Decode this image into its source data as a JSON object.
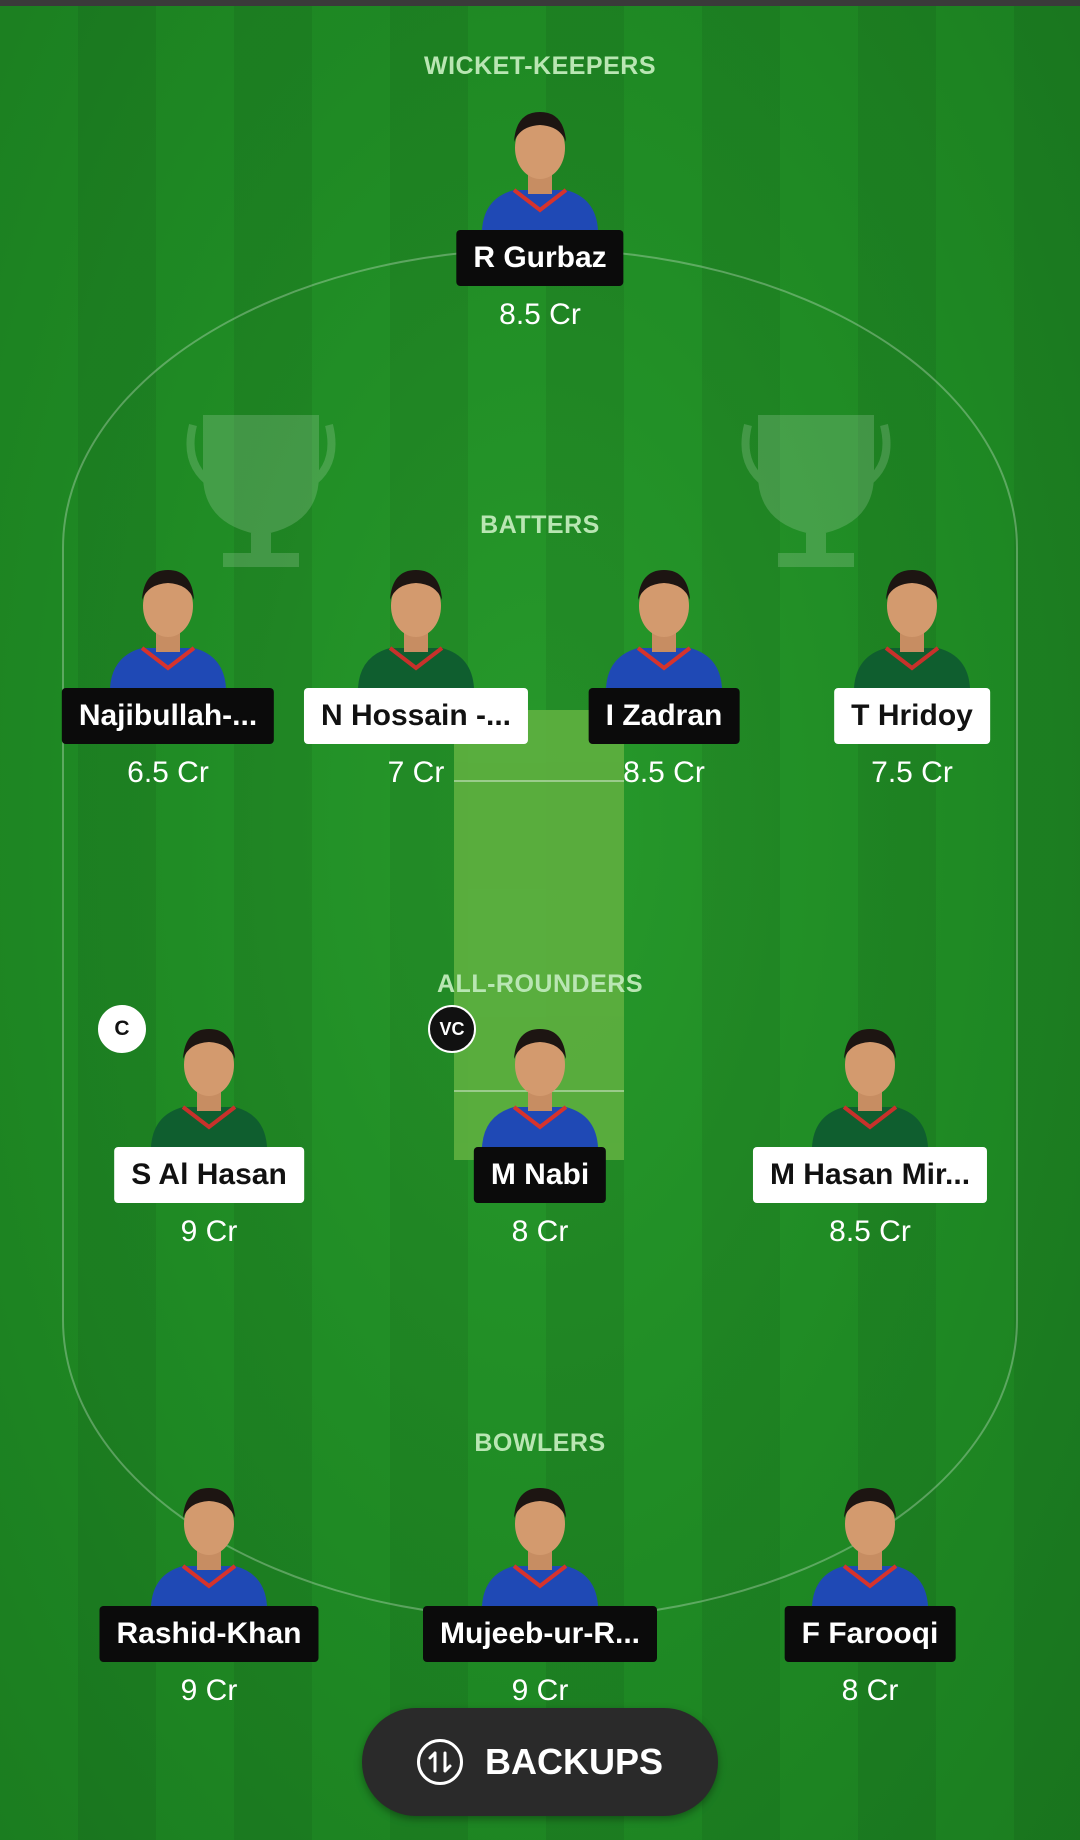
{
  "sections": {
    "wicket_keepers": "WICKET-KEEPERS",
    "batters": "BATTERS",
    "all_rounders": "ALL-ROUNDERS",
    "bowlers": "BOWLERS"
  },
  "players": {
    "wk1": {
      "name": "R Gurbaz",
      "credit": "8.5 Cr",
      "team": "AFG",
      "tag": "dark"
    },
    "bat1": {
      "name": "Najibullah-...",
      "credit": "6.5 Cr",
      "team": "AFG",
      "tag": "dark"
    },
    "bat2": {
      "name": "N Hossain -...",
      "credit": "7 Cr",
      "team": "BAN",
      "tag": "light"
    },
    "bat3": {
      "name": "I Zadran",
      "credit": "8.5 Cr",
      "team": "AFG",
      "tag": "dark"
    },
    "bat4": {
      "name": "T Hridoy",
      "credit": "7.5 Cr",
      "team": "BAN",
      "tag": "light"
    },
    "ar1": {
      "name": "S Al Hasan",
      "credit": "9 Cr",
      "team": "BAN",
      "tag": "light",
      "badge": "C"
    },
    "ar2": {
      "name": "M Nabi",
      "credit": "8 Cr",
      "team": "AFG",
      "tag": "dark",
      "badge": "VC"
    },
    "ar3": {
      "name": "M Hasan Mir...",
      "credit": "8.5 Cr",
      "team": "BAN",
      "tag": "light"
    },
    "bowl1": {
      "name": "Rashid-Khan",
      "credit": "9 Cr",
      "team": "AFG",
      "tag": "dark"
    },
    "bowl2": {
      "name": "Mujeeb-ur-R...",
      "credit": "9 Cr",
      "team": "AFG",
      "tag": "dark"
    },
    "bowl3": {
      "name": "F Farooqi",
      "credit": "8 Cr",
      "team": "AFG",
      "tag": "dark"
    }
  },
  "badges": {
    "captain": "C",
    "vice_captain": "VC"
  },
  "backups_button": {
    "label": "BACKUPS",
    "icon": "swap-icon"
  },
  "colors": {
    "field_green": "#1f8a24",
    "pitch_green": "#5fb040",
    "afg_jersey": "#1f49b5",
    "ban_jersey": "#0f5e2f",
    "label_green": "#b9e6b3"
  }
}
